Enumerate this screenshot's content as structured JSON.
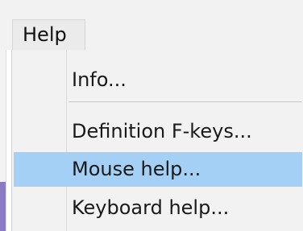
{
  "menubar": {
    "title": "Help"
  },
  "menu": {
    "items": [
      {
        "label": "Info...",
        "highlighted": false
      },
      {
        "label": "Definition F-keys...",
        "highlighted": false
      },
      {
        "label": "Mouse help...",
        "highlighted": true
      },
      {
        "label": "Keyboard help...",
        "highlighted": false
      }
    ]
  },
  "colors": {
    "highlight": "#a5d0f5",
    "menu_background": "#f2f2f2",
    "text": "#1a1a1a"
  }
}
